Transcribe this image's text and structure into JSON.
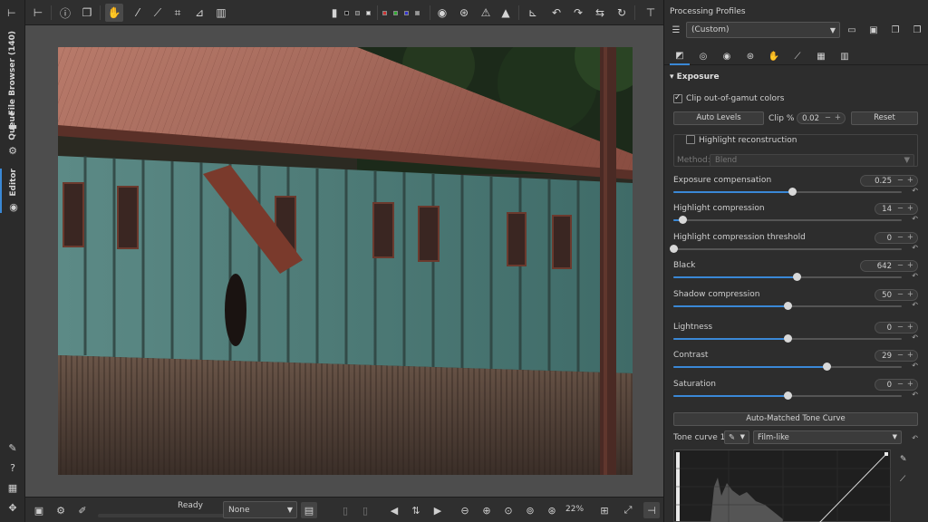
{
  "left_tabs": {
    "file_browser": "File Browser (140)",
    "queue": "Queue",
    "editor": "Editor"
  },
  "toolbar": {
    "tools": [
      "hand-tool",
      "eyedropper",
      "white-balance-picker",
      "crop",
      "straighten",
      "perspective"
    ]
  },
  "statusbar": {
    "status": "Ready",
    "filter_combo": "None",
    "zoom": "22%"
  },
  "profiles": {
    "title": "Processing Profiles",
    "selected": "(Custom)"
  },
  "exposure": {
    "title": "Exposure",
    "clip_gamut_label": "Clip out-of-gamut colors",
    "clip_gamut_checked": true,
    "auto_levels_label": "Auto Levels",
    "clip_pct_label": "Clip %",
    "clip_pct_value": "0.02",
    "reset_label": "Reset",
    "highlight_recon_label": "Highlight reconstruction",
    "highlight_recon_checked": false,
    "method_label": "Method:",
    "method_value": "Blend",
    "sliders": [
      {
        "label": "Exposure compensation",
        "value": "0.25",
        "fraction": 0.52
      },
      {
        "label": "Highlight compression",
        "value": "14",
        "fraction": 0.04
      },
      {
        "label": "Highlight compression threshold",
        "value": "0",
        "fraction": 0.0
      },
      {
        "label": "Black",
        "value": "642",
        "fraction": 0.54
      },
      {
        "label": "Shadow compression",
        "value": "50",
        "fraction": 0.5
      },
      {
        "label": "Lightness",
        "value": "0",
        "fraction": 0.5
      },
      {
        "label": "Contrast",
        "value": "29",
        "fraction": 0.67
      },
      {
        "label": "Saturation",
        "value": "0",
        "fraction": 0.5
      }
    ],
    "auto_matched_label": "Auto-Matched Tone Curve",
    "tone_curve_label": "Tone curve 1:",
    "tone_curve_mode": "Film-like"
  },
  "colors": {
    "accent": "#3a88d6"
  }
}
